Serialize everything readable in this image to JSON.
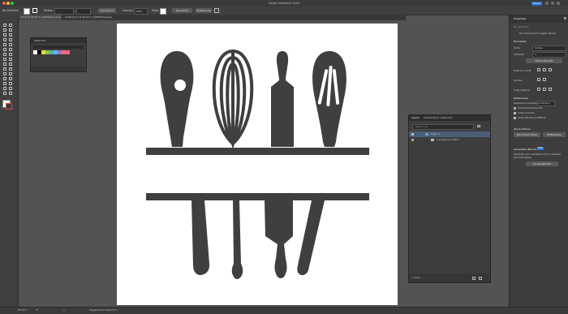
{
  "window": {
    "title": "Adobe Illustrator 2024",
    "share_label": "Share"
  },
  "controlbar": {
    "selection": "No Selection",
    "stroke_label": "Stroke:",
    "brush_value": "5 pt. Round",
    "opacity_label": "Opacity:",
    "opacity_value": "100%",
    "style_label": "Style:",
    "document_setup": "Document Setup",
    "preferences": "Preferences"
  },
  "tabs": [
    {
      "label": "Tool* @ 80.67 % (CMYK/Preview)"
    },
    {
      "label": "Untitled-1* @ 80.67 % (CMYK/Preview)"
    }
  ],
  "swatches": {
    "title": "Swatches",
    "colors": [
      "#ffffff",
      "#000000",
      "#e8d84a",
      "#8bc34a",
      "#4db6ac",
      "#64b5f6",
      "#9575cd",
      "#e57373",
      "#f06292"
    ]
  },
  "layers": {
    "tabs": [
      "Layers",
      "Asset Export",
      "Artboards"
    ],
    "search_placeholder": "Search All",
    "layer_name": "Layer 1",
    "sublayer_name": "<Compound Path>",
    "footer_count": "1 Layer"
  },
  "properties": {
    "title": "Properties",
    "section": "No Selection",
    "doc_title": "Tool Document Graphic Name",
    "document_label": "Document",
    "units_label": "Units",
    "units_value": "Inches",
    "artboard_label": "Artboard",
    "artboard_value": "1",
    "edit_artboards": "Edit Artboards",
    "rulers_grids": "Rulers & Grids",
    "guides": "Guides",
    "snap_options": "Snap Options",
    "preferences_label": "Preferences",
    "keyboard_increment_label": "Keyboard Increment",
    "keyboard_increment_value": "0.0139 in",
    "checkbox_preview_bounds": "Use Preview Bounds",
    "checkbox_scale_corners": "Scale Corners",
    "checkbox_scale_strokes": "Scale Strokes & Effects",
    "quick_actions": "Quick Actions",
    "document_setup_btn": "Document Setup",
    "preferences_btn": "Preferences",
    "generative_recolor": "Generative Recolor",
    "beta_badge": "Beta",
    "recolor_desc": "Generate color variations from a detailed text description",
    "try_sample_btn": "Try Sample File"
  },
  "status": {
    "zoom": "80.67%",
    "rotation": "0°",
    "artboard_nav": "1",
    "tool_name": "Toggle Direct Selection"
  },
  "artwork": {
    "fill": "#3f3f42"
  }
}
